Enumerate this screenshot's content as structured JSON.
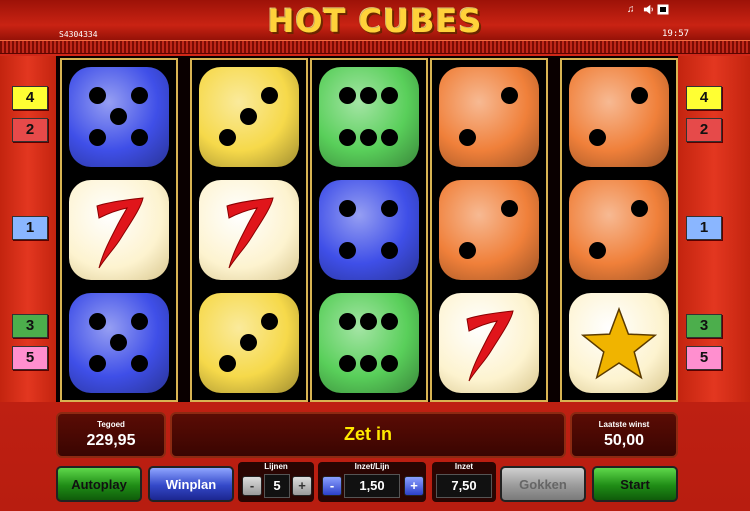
{
  "header": {
    "title": "HOT CUBES",
    "game_id": "S4304334",
    "clock": "19:57",
    "icons": [
      "music-note-icon",
      "speaker-icon",
      "fullscreen-icon"
    ]
  },
  "reels": [
    [
      "blue-five",
      "cherry-seven",
      "blue-five"
    ],
    [
      "yellow-three",
      "cherry-seven",
      "yellow-three"
    ],
    [
      "green-six",
      "blue-four",
      "green-six"
    ],
    [
      "orange-two",
      "orange-two",
      "cherry-seven"
    ],
    [
      "orange-two",
      "orange-two",
      "gold-star"
    ]
  ],
  "lines_left": [
    {
      "label": "4",
      "color": "#ffff33"
    },
    {
      "label": "2",
      "color": "#e64a4a"
    },
    {
      "label": "1",
      "color": "#8ab6ff"
    },
    {
      "label": "3",
      "color": "#4cae4c"
    },
    {
      "label": "5",
      "color": "#ff8fcf"
    }
  ],
  "lines_right": [
    {
      "label": "4",
      "color": "#ffff33"
    },
    {
      "label": "2",
      "color": "#e64a4a"
    },
    {
      "label": "1",
      "color": "#8ab6ff"
    },
    {
      "label": "3",
      "color": "#4cae4c"
    },
    {
      "label": "5",
      "color": "#ff8fcf"
    }
  ],
  "info": {
    "balance_label": "Tegoed",
    "balance_value": "229,95",
    "message": "Zet in",
    "last_win_label": "Laatste winst",
    "last_win_value": "50,00"
  },
  "controls": {
    "autoplay_label": "Autoplay",
    "winplan_label": "Winplan",
    "lines_label": "Lijnen",
    "lines_value": "5",
    "bet_per_line_label": "Inzet/Lijn",
    "bet_per_line_value": "1,50",
    "total_bet_label": "Inzet",
    "total_bet_value": "7,50",
    "gamble_label": "Gokken",
    "start_label": "Start",
    "minus": "-",
    "plus": "+"
  },
  "colors": {
    "blue_die": "#3f4fe8",
    "yellow_die": "#f6d94a",
    "green_die": "#59cf5a",
    "orange_die": "#f0803a",
    "cream_die": "#fdf3cf",
    "seven_red": "#e0151b",
    "star_gold": "#f0b400"
  }
}
